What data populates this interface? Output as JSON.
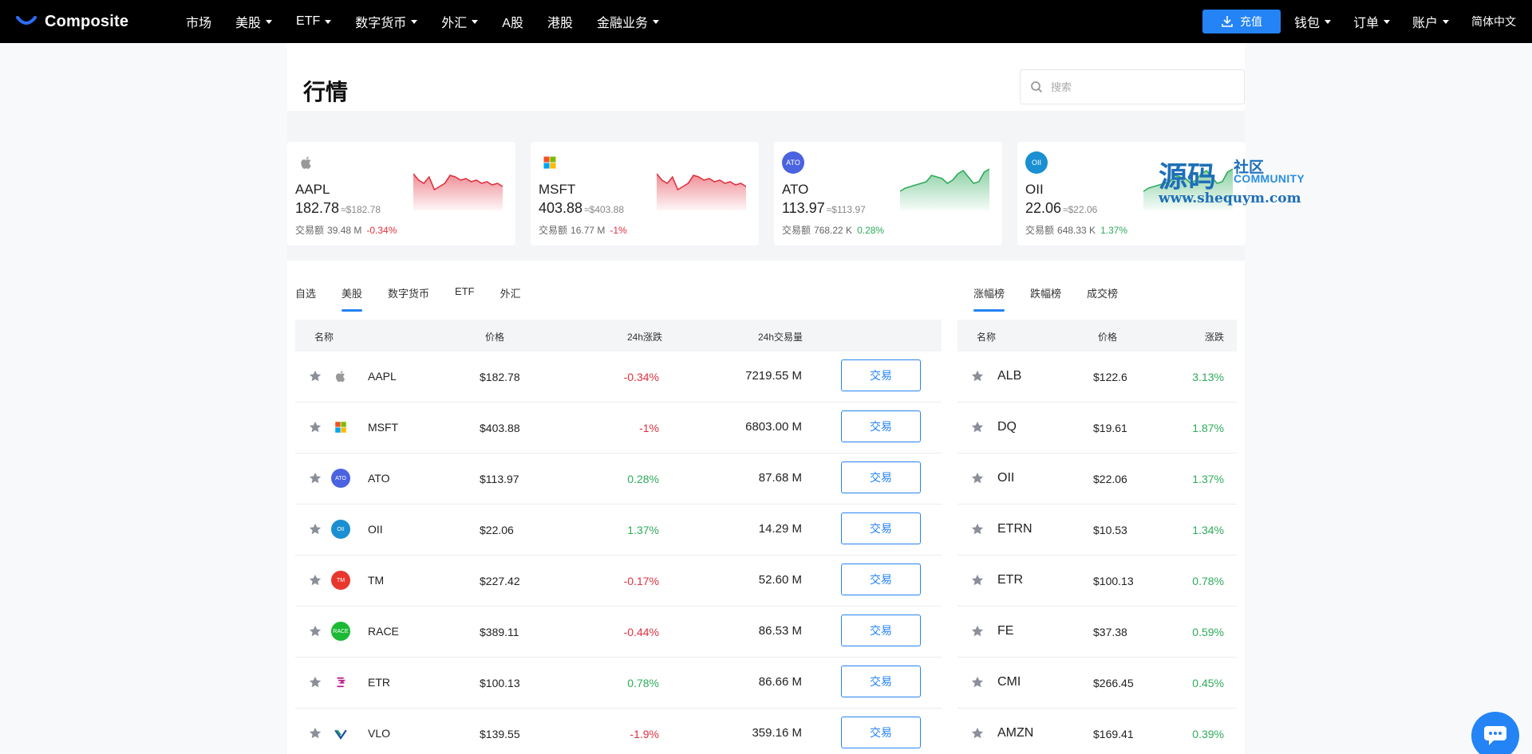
{
  "nav": {
    "logo_text": "Composite",
    "items": [
      {
        "label": "市场",
        "dropdown": false
      },
      {
        "label": "美股",
        "dropdown": true
      },
      {
        "label": "ETF",
        "dropdown": true
      },
      {
        "label": "数字货币",
        "dropdown": true
      },
      {
        "label": "外汇",
        "dropdown": true
      },
      {
        "label": "A股",
        "dropdown": false
      },
      {
        "label": "港股",
        "dropdown": false
      },
      {
        "label": "金融业务",
        "dropdown": true
      }
    ],
    "deposit_label": "充值",
    "wallet_label": "钱包",
    "orders_label": "订单",
    "account_label": "账户",
    "language": "简体中文"
  },
  "page": {
    "title": "行情",
    "search_placeholder": "搜索"
  },
  "colors": {
    "accent": "#2483f5",
    "down": "#e0303f",
    "up": "#2eab5b"
  },
  "cards": [
    {
      "symbol": "AAPL",
      "price": "182.78",
      "approx": "≈$182.78",
      "volume_label": "交易额",
      "volume": "39.48 M",
      "change": "-0.34%",
      "direction": "down",
      "icon": "apple-icon"
    },
    {
      "symbol": "MSFT",
      "price": "403.88",
      "approx": "≈$403.88",
      "volume_label": "交易额",
      "volume": "16.77 M",
      "change": "-1%",
      "direction": "down",
      "icon": "microsoft-icon"
    },
    {
      "symbol": "ATO",
      "price": "113.97",
      "approx": "≈$113.97",
      "volume_label": "交易额",
      "volume": "768.22 K",
      "change": "0.28%",
      "direction": "up",
      "icon_text": "ATO",
      "icon_color": "#4a63e0"
    },
    {
      "symbol": "OII",
      "price": "22.06",
      "approx": "≈$22.06",
      "volume_label": "交易额",
      "volume": "648.33 K",
      "change": "1.37%",
      "direction": "up",
      "icon_text": "OII",
      "icon_color": "#1a8fd1"
    }
  ],
  "watermark": {
    "big": "源码",
    "she": "社区",
    "community": "COMMUNITY",
    "url": "www.shequym.com"
  },
  "market_tabs": [
    "自选",
    "美股",
    "数字货币",
    "ETF",
    "外汇"
  ],
  "market_tab_active": 1,
  "market_table": {
    "headers": {
      "name": "名称",
      "price": "价格",
      "change": "24h涨跌",
      "volume": "24h交易量"
    },
    "trade_label": "交易",
    "rows": [
      {
        "symbol": "AAPL",
        "price": "$182.78",
        "change": "-0.34%",
        "direction": "down",
        "volume": "7219.55 M",
        "icon": "apple-icon"
      },
      {
        "symbol": "MSFT",
        "price": "$403.88",
        "change": "-1%",
        "direction": "down",
        "volume": "6803.00 M",
        "icon": "microsoft-icon"
      },
      {
        "symbol": "ATO",
        "price": "$113.97",
        "change": "0.28%",
        "direction": "up",
        "volume": "87.68 M",
        "icon_text": "ATO",
        "icon_color": "#4a63e0"
      },
      {
        "symbol": "OII",
        "price": "$22.06",
        "change": "1.37%",
        "direction": "up",
        "volume": "14.29 M",
        "icon_text": "OII",
        "icon_color": "#1a8fd1"
      },
      {
        "symbol": "TM",
        "price": "$227.42",
        "change": "-0.17%",
        "direction": "down",
        "volume": "52.60 M",
        "icon_text": "TM",
        "icon_color": "#e8382e"
      },
      {
        "symbol": "RACE",
        "price": "$389.11",
        "change": "-0.44%",
        "direction": "down",
        "volume": "86.53 M",
        "icon_text": "RACE",
        "icon_color": "#1bb934"
      },
      {
        "symbol": "ETR",
        "price": "$100.13",
        "change": "0.78%",
        "direction": "up",
        "volume": "86.66 M",
        "icon": "entergy-icon"
      },
      {
        "symbol": "VLO",
        "price": "$139.55",
        "change": "-1.9%",
        "direction": "down",
        "volume": "359.16 M",
        "icon": "valero-icon"
      }
    ]
  },
  "rank_tabs": [
    "涨幅榜",
    "跌幅榜",
    "成交榜"
  ],
  "rank_tab_active": 0,
  "rank_table": {
    "headers": {
      "name": "名称",
      "price": "价格",
      "change": "涨跌"
    },
    "rows": [
      {
        "symbol": "ALB",
        "price": "$122.6",
        "change": "3.13%"
      },
      {
        "symbol": "DQ",
        "price": "$19.61",
        "change": "1.87%"
      },
      {
        "symbol": "OII",
        "price": "$22.06",
        "change": "1.37%"
      },
      {
        "symbol": "ETRN",
        "price": "$10.53",
        "change": "1.34%"
      },
      {
        "symbol": "ETR",
        "price": "$100.13",
        "change": "0.78%"
      },
      {
        "symbol": "FE",
        "price": "$37.38",
        "change": "0.59%"
      },
      {
        "symbol": "CMI",
        "price": "$266.45",
        "change": "0.45%"
      },
      {
        "symbol": "AMZN",
        "price": "$169.41",
        "change": "0.39%"
      }
    ]
  }
}
